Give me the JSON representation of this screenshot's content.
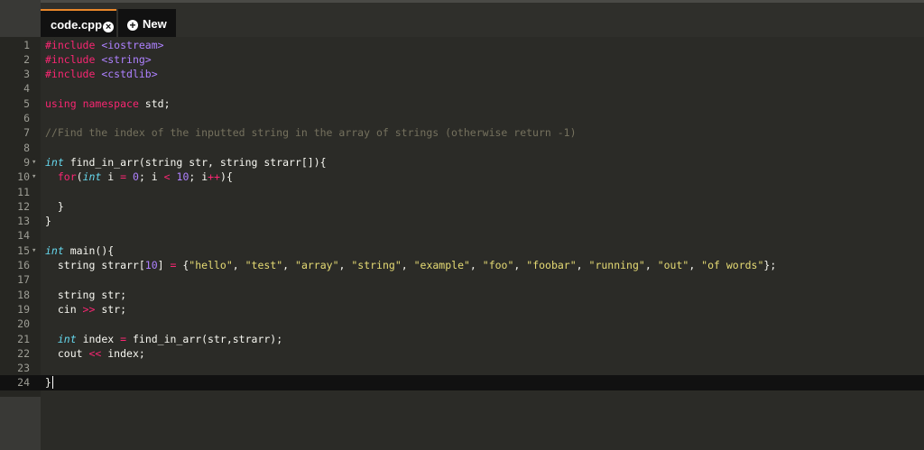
{
  "tabs": [
    {
      "label": "code.cpp",
      "icon": "close-circle-icon",
      "active": true
    },
    {
      "label": "New",
      "icon": "plus-circle-icon",
      "active": false
    }
  ],
  "editor": {
    "language": "cpp",
    "active_line": 24,
    "lines": [
      {
        "n": "1",
        "text": "#include <iostream>"
      },
      {
        "n": "2",
        "text": "#include <string>"
      },
      {
        "n": "3",
        "text": "#include <cstdlib>"
      },
      {
        "n": "4",
        "text": ""
      },
      {
        "n": "5",
        "text": "using namespace std;"
      },
      {
        "n": "6",
        "text": ""
      },
      {
        "n": "7",
        "text": "//Find the index of the inputted string in the array of strings (otherwise return -1)"
      },
      {
        "n": "8",
        "text": ""
      },
      {
        "n": "9",
        "text": "int find_in_arr(string str, string strarr[]){",
        "fold": true
      },
      {
        "n": "10",
        "text": "  for(int i = 0; i < 10; i++){",
        "fold": true
      },
      {
        "n": "11",
        "text": ""
      },
      {
        "n": "12",
        "text": "  }"
      },
      {
        "n": "13",
        "text": "}"
      },
      {
        "n": "14",
        "text": ""
      },
      {
        "n": "15",
        "text": "int main(){",
        "fold": true
      },
      {
        "n": "16",
        "text": "  string strarr[10] = {\"hello\", \"test\", \"array\", \"string\", \"example\", \"foo\", \"foobar\", \"running\", \"out\", \"of words\"};"
      },
      {
        "n": "17",
        "text": ""
      },
      {
        "n": "18",
        "text": "  string str;"
      },
      {
        "n": "19",
        "text": "  cin >> str;"
      },
      {
        "n": "20",
        "text": ""
      },
      {
        "n": "21",
        "text": "  int index = find_in_arr(str,strarr);"
      },
      {
        "n": "22",
        "text": "  cout << index;"
      },
      {
        "n": "23",
        "text": ""
      },
      {
        "n": "24",
        "text": "}"
      }
    ]
  },
  "colors": {
    "keyword": "#f92672",
    "type": "#66d9ef",
    "string": "#e6db74",
    "include": "#ae81ff",
    "comment": "#75715e",
    "tab_accent": "#e8862a"
  }
}
